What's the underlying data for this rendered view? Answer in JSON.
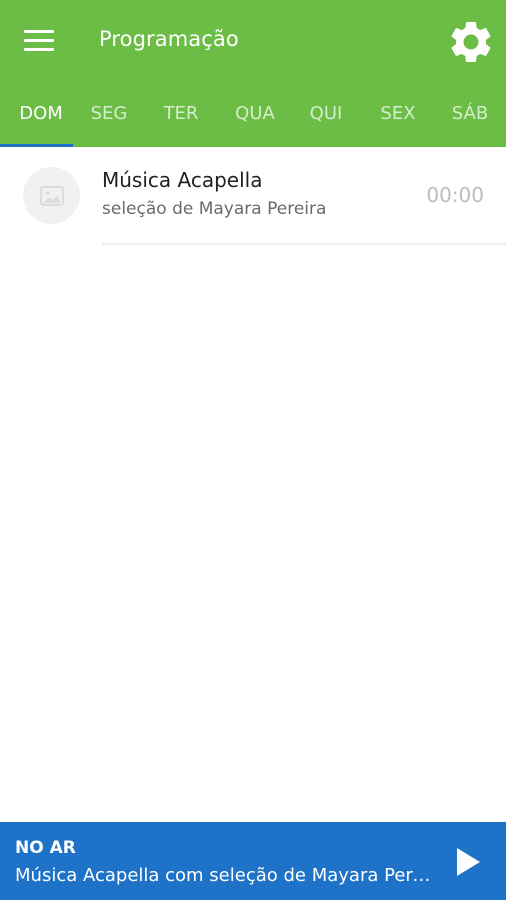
{
  "app": {
    "title": "Programação",
    "colors": {
      "appbar": "#6cbd45",
      "accent": "#1e73c8",
      "player": "#1e73c8"
    },
    "icons": {
      "menu": "menu-icon",
      "settings": "gear-icon",
      "thumb": "image-placeholder-icon",
      "play": "play-icon"
    }
  },
  "tabs": [
    {
      "label": "DOM",
      "active": true
    },
    {
      "label": "SEG",
      "active": false
    },
    {
      "label": "TER",
      "active": false
    },
    {
      "label": "QUA",
      "active": false
    },
    {
      "label": "QUI",
      "active": false
    },
    {
      "label": "SEX",
      "active": false
    },
    {
      "label": "SÁB",
      "active": false
    }
  ],
  "schedule": [
    {
      "title": "Música Acapella",
      "subtitle": "seleção de Mayara Pereira",
      "time": "00:00"
    }
  ],
  "player": {
    "status": "NO AR",
    "now_playing": "Música Acapella com seleção de Mayara Pereira"
  }
}
